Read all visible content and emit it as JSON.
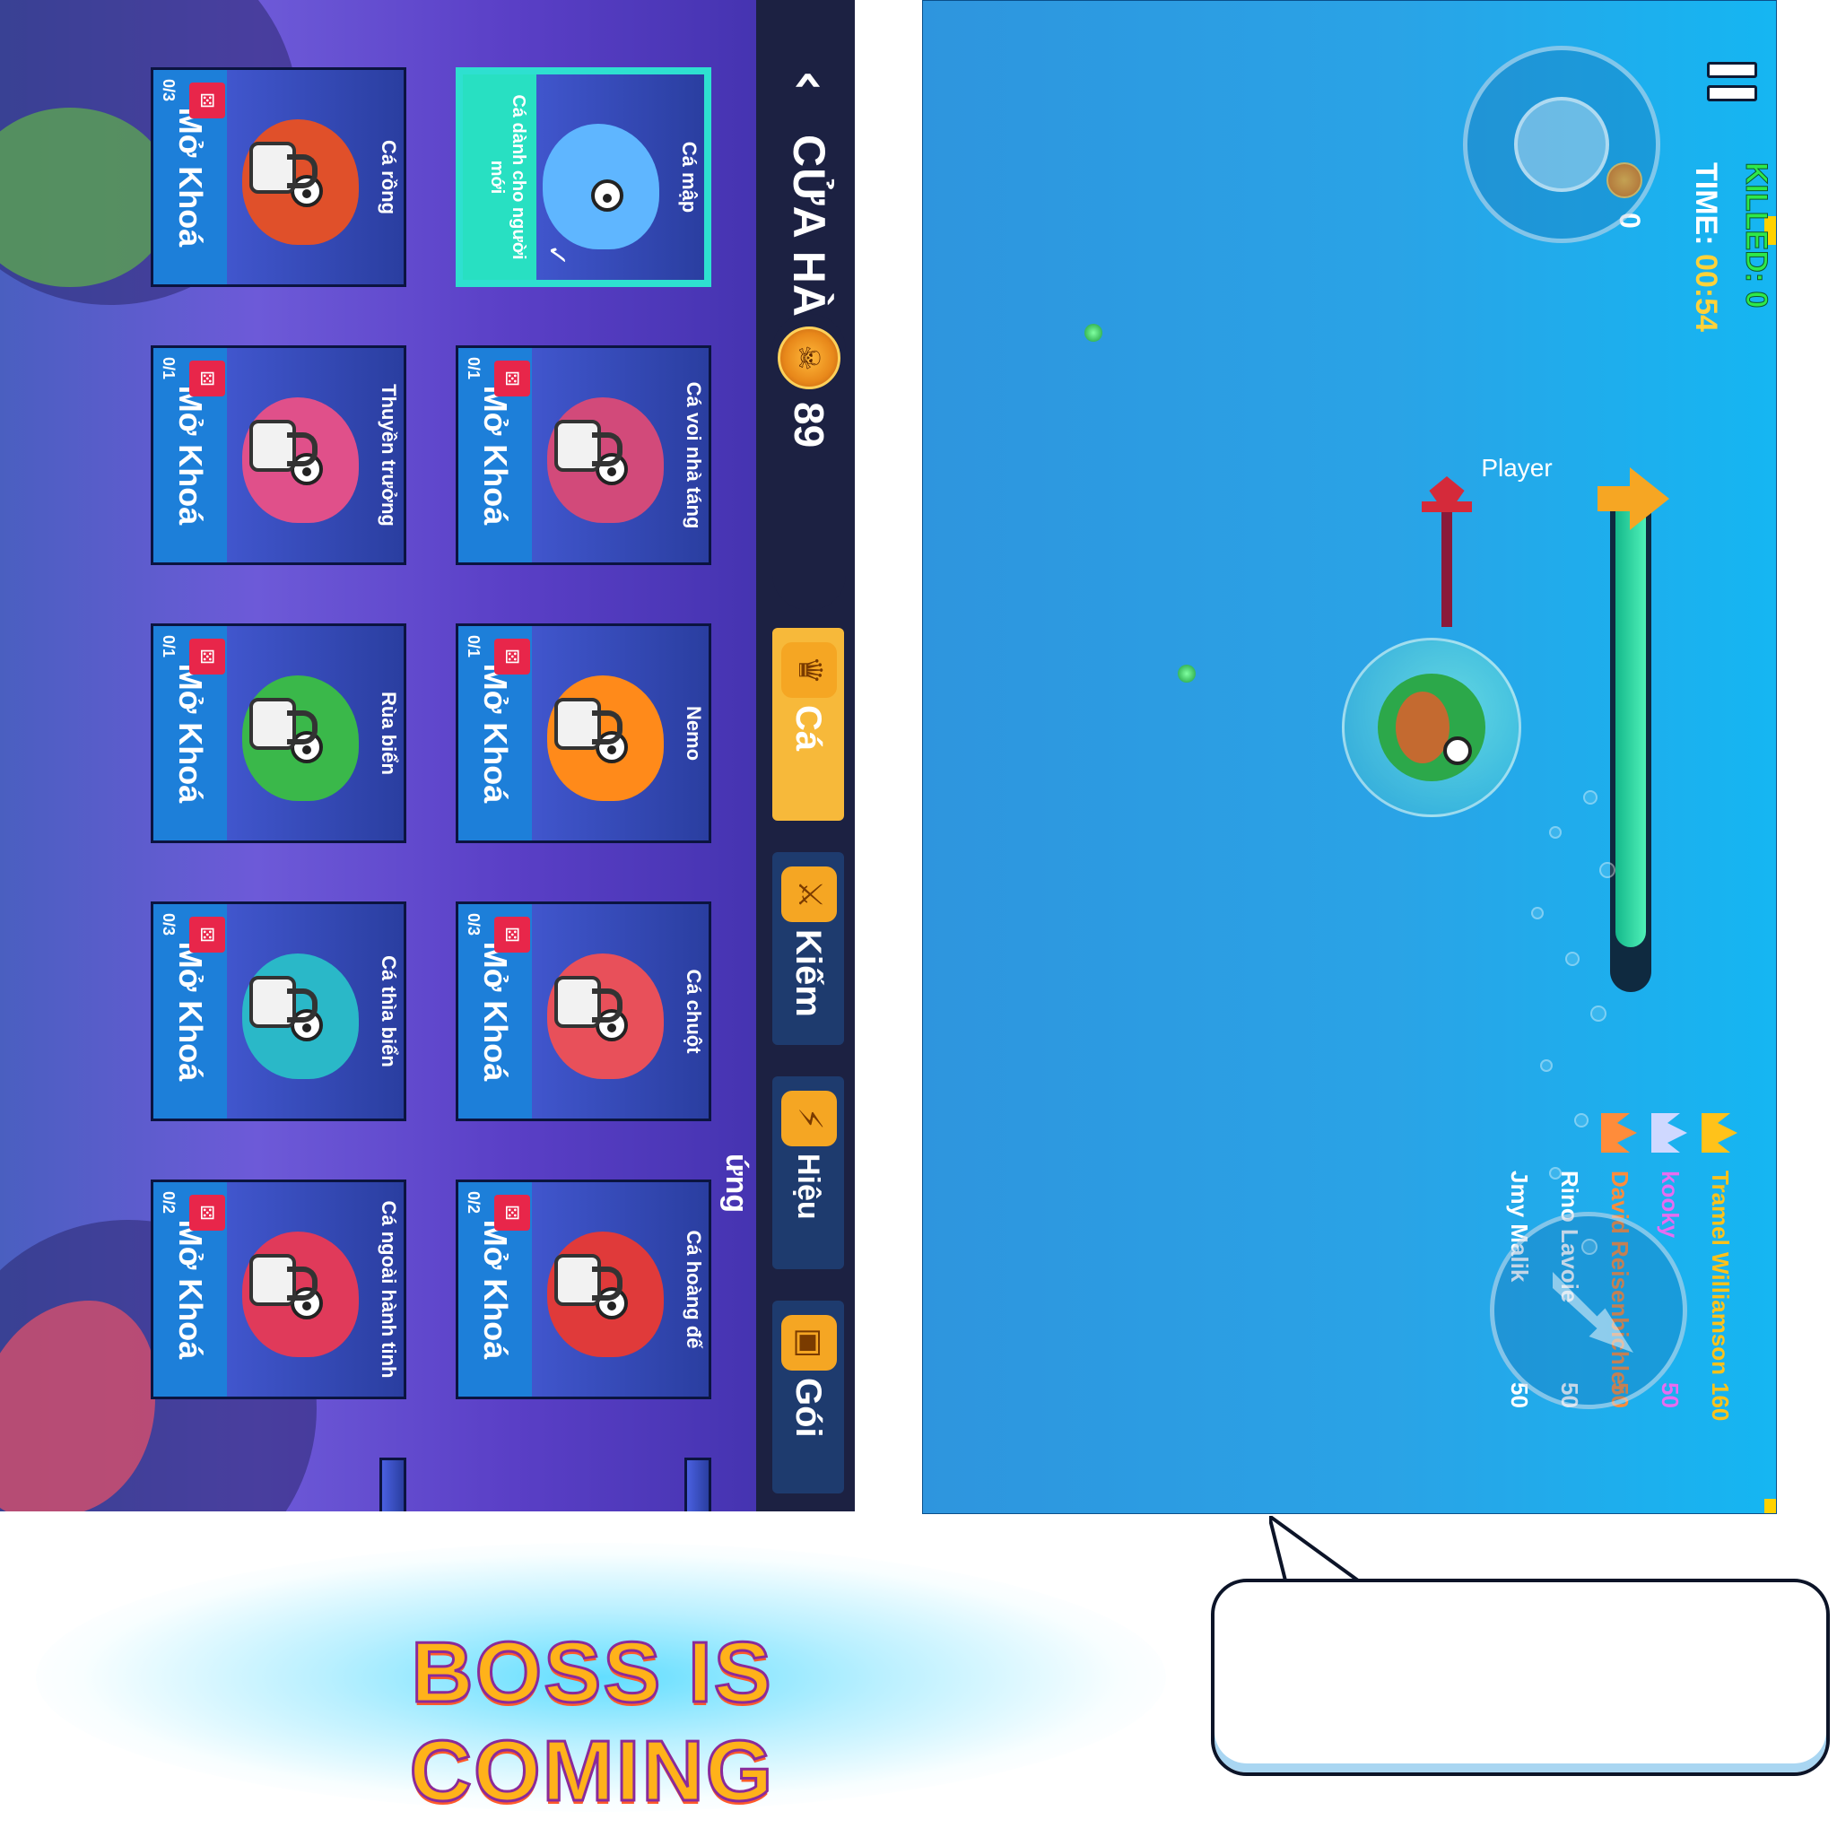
{
  "shop": {
    "title": "CỬA HÀNG",
    "coins": "89",
    "coin_icon": "skull-coin-icon",
    "tabs": [
      {
        "label": "Cá",
        "icon": "fish-crown-icon",
        "active": true
      },
      {
        "label": "Kiếm",
        "icon": "sword-icon",
        "active": false
      },
      {
        "label": "Hiệu ứng",
        "icon": "lightning-icon",
        "active": false
      },
      {
        "label": "Gói",
        "icon": "treasure-chest-icon",
        "active": false
      }
    ],
    "cards": [
      {
        "name": "Cá mập",
        "status": "Cá dành cho người mới",
        "selected": true,
        "color": "#5fb6ff"
      },
      {
        "name": "Cá voi nhà táng",
        "unlock": "Mở Khoá",
        "count": "0/1",
        "color": "#d24a7a"
      },
      {
        "name": "Nemo",
        "unlock": "Mở Khoá",
        "count": "0/1",
        "color": "#ff8a1a"
      },
      {
        "name": "Cá chuột",
        "unlock": "Mở Khoá",
        "count": "0/3",
        "color": "#e8505a"
      },
      {
        "name": "Cá hoàng đế",
        "unlock": "Mở Khoá",
        "count": "0/2",
        "color": "#e03a3a"
      },
      {
        "name": "Cá rồng",
        "unlock": "Mở Khoá",
        "count": "0/3",
        "color": "#e0502a"
      },
      {
        "name": "Thuyền trưởng",
        "unlock": "Mở Khoá",
        "count": "0/1",
        "color": "#e0508a"
      },
      {
        "name": "Rùa biển",
        "unlock": "Mở Khoá",
        "count": "0/1",
        "color": "#3ab84a"
      },
      {
        "name": "Cá thìa biển",
        "unlock": "Mở Khoá",
        "count": "0/3",
        "color": "#2ab8c8"
      },
      {
        "name": "Cá ngoài hành tinh",
        "unlock": "Mở Khoá",
        "count": "0/2",
        "color": "#e03a5a"
      }
    ]
  },
  "game": {
    "killed_label": "KILLED: 0",
    "time_prefix": "TIME: ",
    "time_value": "00:54",
    "gold": "0",
    "progress": 0.92,
    "player_name": "Player",
    "leaderboard": [
      {
        "rank_icon": "gold-crown-icon",
        "name": "Tramel Williamson",
        "score": "160",
        "color": "#ffc21a"
      },
      {
        "rank_icon": "silver-crown-icon",
        "name": "kooky",
        "score": "50",
        "color": "#e86cf0"
      },
      {
        "rank_icon": "bronze-crown-icon",
        "name": "David Reisenbichler",
        "score": "50",
        "color": "#ff8c3a"
      },
      {
        "rank_icon": "",
        "name": "Rino Lavoie",
        "score": "50",
        "color": "#ffffff"
      },
      {
        "rank_icon": "",
        "name": "Jmy Malik",
        "score": "50",
        "color": "#ffffff"
      }
    ]
  },
  "banner": {
    "text": "BOSS IS COMING"
  },
  "speech": {
    "text": ""
  }
}
